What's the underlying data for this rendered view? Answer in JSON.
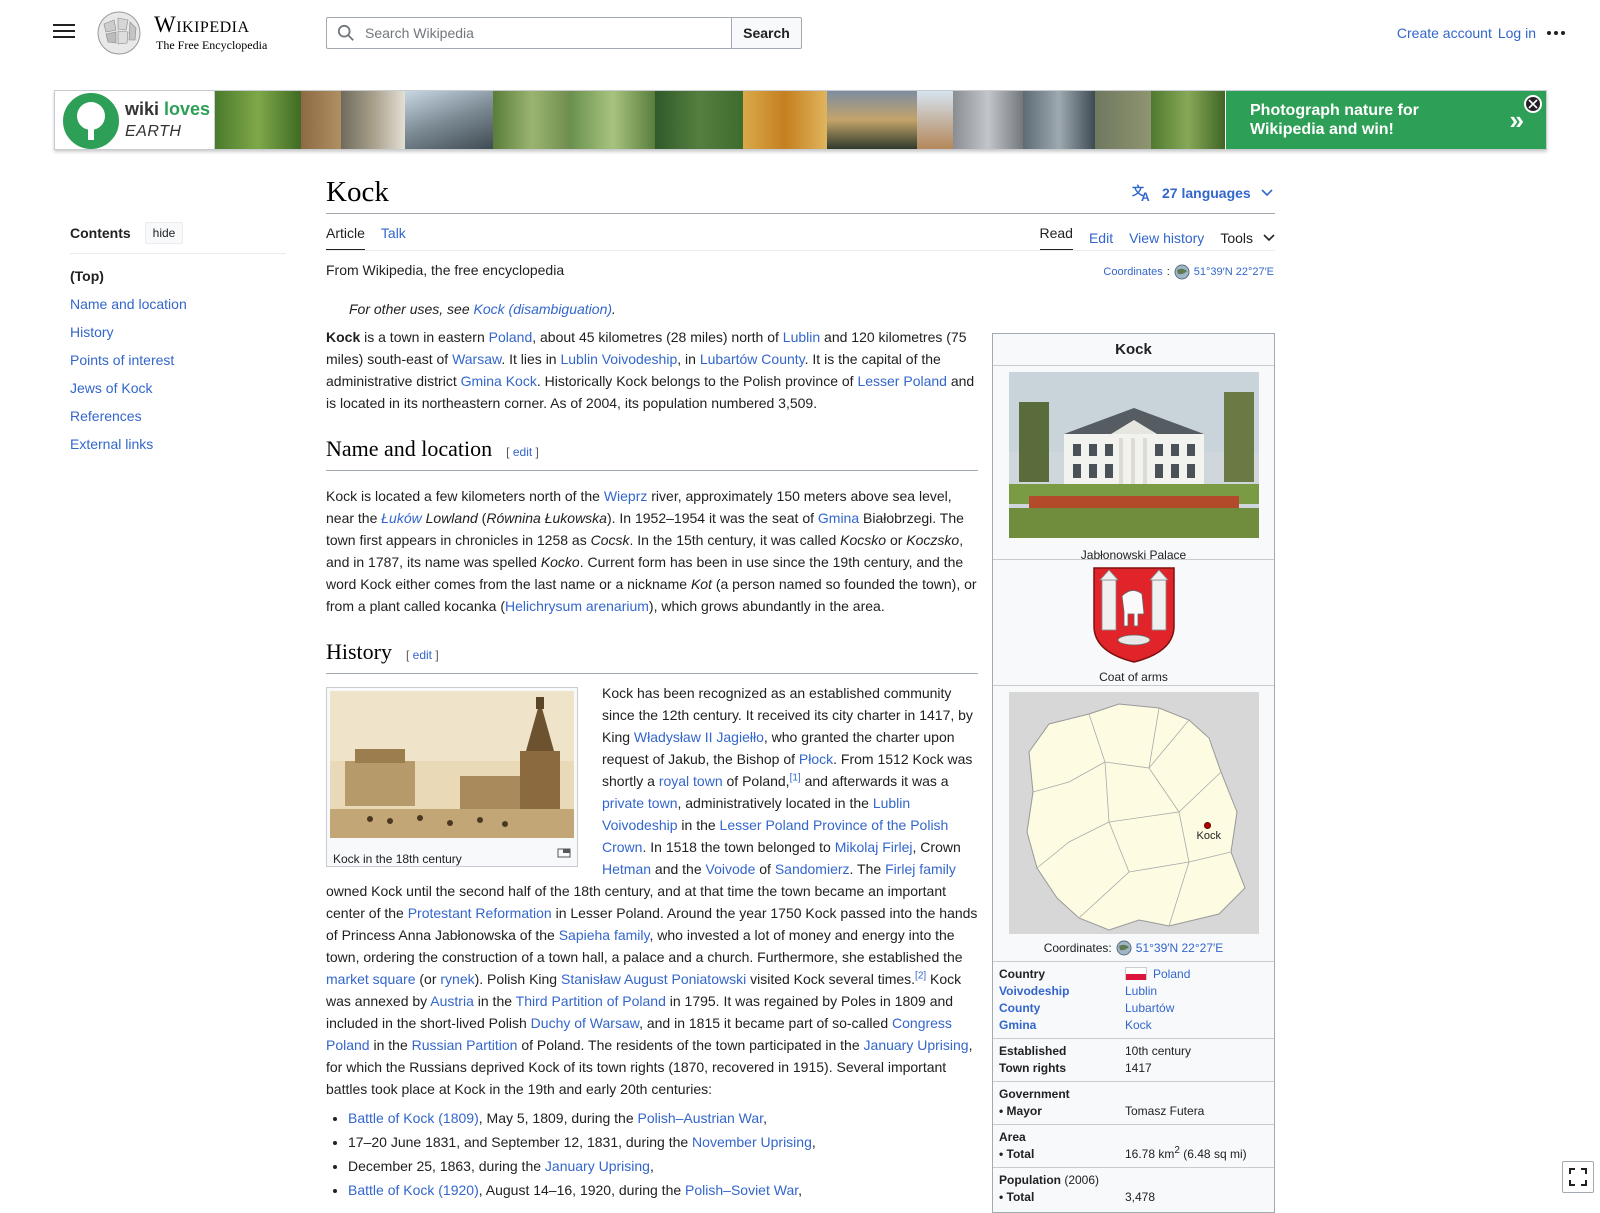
{
  "header": {
    "wordmark": "Wikipedia",
    "tagline": "The Free Encyclopedia",
    "search_placeholder": "Search Wikipedia",
    "search_button": "Search",
    "create_account": "Create account",
    "log_in": "Log in"
  },
  "banner": {
    "logo_wiki": "wiki",
    "logo_loves": "loves",
    "logo_earth": "EARTH",
    "cta_line1": "Photograph nature for",
    "cta_line2": "Wikipedia and win!",
    "cta_arrow": "»"
  },
  "toc": {
    "title": "Contents",
    "hide": "hide",
    "items": [
      "(Top)",
      "Name and location",
      "History",
      "Points of interest",
      "Jews of Kock",
      "References",
      "External links"
    ]
  },
  "page": {
    "title": "Kock",
    "languages": "27 languages",
    "tabs_left": [
      "Article",
      "Talk"
    ],
    "tabs_right": [
      "Read",
      "Edit",
      "View history",
      "Tools"
    ],
    "tagline": "From Wikipedia, the free encyclopedia",
    "coords_label": "Coordinates",
    "coords_value": "51°39′N 22°27′E",
    "hatnote_prefix": "For other uses, see ",
    "hatnote_link": "Kock (disambiguation)",
    "hatnote_suffix": "."
  },
  "sections": {
    "name": "Name and location",
    "history": "History",
    "edit": "edit"
  },
  "thumb_caption": "Kock in the 18th century",
  "battles": [
    {
      "link": "Battle of Kock (1809)",
      "text": ", May 5, 1809, during the ",
      "link2": "Polish–Austrian War",
      "end": ","
    },
    {
      "link": "",
      "text": "17–20 June 1831, and September 12, 1831, during the ",
      "link2": "November Uprising",
      "end": ","
    },
    {
      "link": "",
      "text": "December 25, 1863, during the ",
      "link2": "January Uprising",
      "end": ","
    },
    {
      "link": "Battle of Kock (1920)",
      "text": ", August 14–16, 1920, during the ",
      "link2": "Polish–Soviet War",
      "end": ","
    }
  ],
  "infobox": {
    "title": "Kock",
    "image1_caption": "Jabłonowski Palace",
    "image2_caption": "Coat of arms",
    "map_marker": "Kock",
    "coords_label": "Coordinates:",
    "coords_value": "51°39′N 22°27′E",
    "rows1": [
      {
        "k": "Country",
        "v": "Poland",
        "klink": false
      },
      {
        "k": "Voivodeship",
        "v": "Lublin",
        "klink": true
      },
      {
        "k": "County",
        "v": "Lubartów",
        "klink": true
      },
      {
        "k": "Gmina",
        "v": "Kock",
        "klink": true
      }
    ],
    "rows2": [
      {
        "k": "Established",
        "v": "10th century"
      },
      {
        "k": "Town rights",
        "v": "1417"
      }
    ],
    "gov_label": "Government",
    "mayor_label": "• Mayor",
    "mayor_value": "Tomasz Futera",
    "area_label": "Area",
    "area_total_label": "• Total",
    "area_total_value_a": "16.78 km",
    "area_total_sup": "2",
    "area_total_value_b": " (6.48 sq mi)",
    "pop_label": "Population",
    "pop_year": " (2006)",
    "pop_total_label": "• Total",
    "pop_total_value": "3,478"
  },
  "colors": {
    "link": "#3366cc",
    "banner_green": "#2e9f56",
    "text": "#202122"
  }
}
